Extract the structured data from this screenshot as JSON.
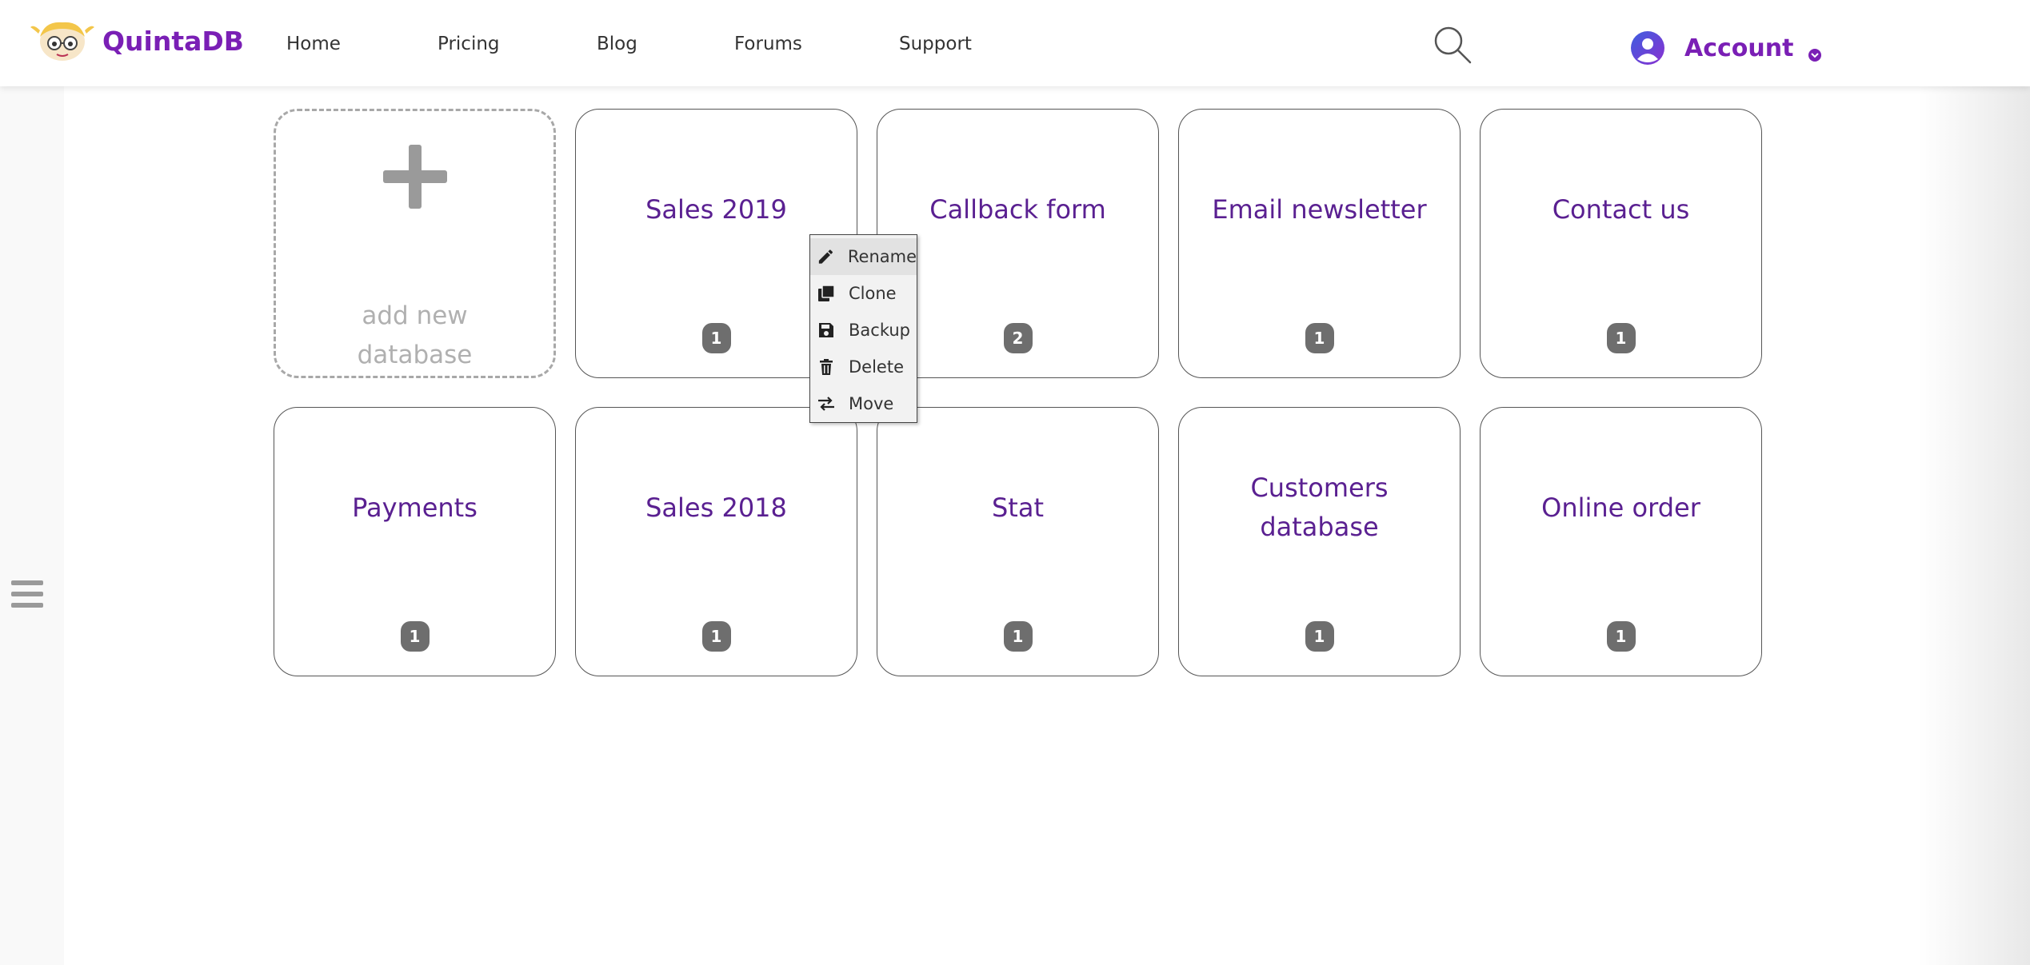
{
  "header": {
    "brand": "QuintaDB",
    "nav": [
      "Home",
      "Pricing",
      "Blog",
      "Forums",
      "Support"
    ],
    "account_label": "Account"
  },
  "colors": {
    "brand": "#7a1fb5",
    "card_title": "#5a2091",
    "badge": "#6e6e6e"
  },
  "add_card": {
    "label": "add new database"
  },
  "databases": [
    {
      "name": "Sales 2019",
      "count": "1"
    },
    {
      "name": "Callback form",
      "count": "2"
    },
    {
      "name": "Email newsletter",
      "count": "1"
    },
    {
      "name": "Contact us",
      "count": "1"
    },
    {
      "name": "Payments",
      "count": "1"
    },
    {
      "name": "Sales 2018",
      "count": "1"
    },
    {
      "name": "Stat",
      "count": "1"
    },
    {
      "name": "Customers database",
      "count": "1"
    },
    {
      "name": "Online order",
      "count": "1"
    }
  ],
  "context_menu": {
    "items": [
      {
        "label": "Rename",
        "icon": "pencil-icon"
      },
      {
        "label": "Clone",
        "icon": "copy-icon"
      },
      {
        "label": "Backup",
        "icon": "floppy-icon"
      },
      {
        "label": "Delete",
        "icon": "trash-icon"
      },
      {
        "label": "Move",
        "icon": "swap-arrows-icon"
      }
    ]
  }
}
